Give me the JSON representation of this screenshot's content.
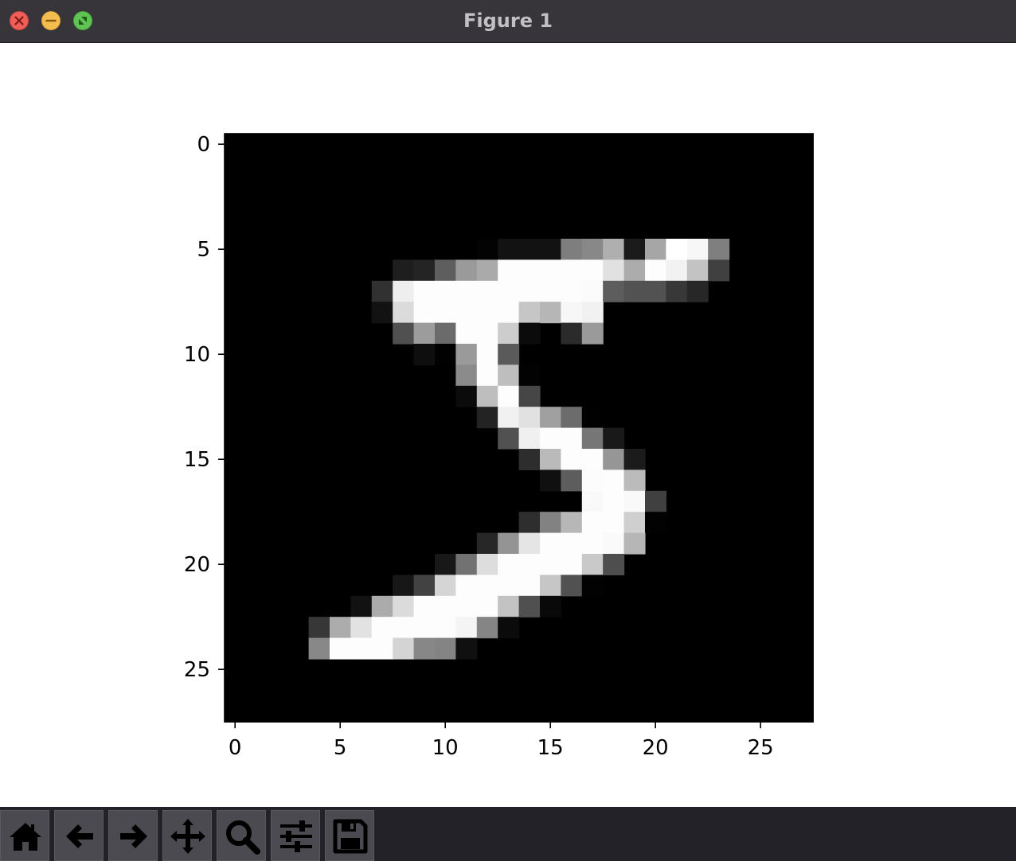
{
  "window": {
    "title": "Figure 1"
  },
  "toolbar": {
    "buttons": [
      {
        "name": "home",
        "icon": "home-icon"
      },
      {
        "name": "back",
        "icon": "arrow-left-icon"
      },
      {
        "name": "forward",
        "icon": "arrow-right-icon"
      },
      {
        "name": "pan",
        "icon": "move-icon"
      },
      {
        "name": "zoom",
        "icon": "magnifier-icon"
      },
      {
        "name": "configure-subplots",
        "icon": "sliders-icon"
      },
      {
        "name": "save",
        "icon": "floppy-disk-icon"
      }
    ]
  },
  "chart_data": {
    "type": "heatmap",
    "colormap": "gray",
    "xlim": [
      -0.5,
      27.5
    ],
    "ylim": [
      27.5,
      -0.5
    ],
    "xticks": [
      "0",
      "5",
      "10",
      "15",
      "20",
      "25"
    ],
    "yticks": [
      "0",
      "5",
      "10",
      "15",
      "20",
      "25"
    ],
    "rows": 28,
    "cols": 28,
    "values": [
      [
        0,
        0,
        0,
        0,
        0,
        0,
        0,
        0,
        0,
        0,
        0,
        0,
        0,
        0,
        0,
        0,
        0,
        0,
        0,
        0,
        0,
        0,
        0,
        0,
        0,
        0,
        0,
        0
      ],
      [
        0,
        0,
        0,
        0,
        0,
        0,
        0,
        0,
        0,
        0,
        0,
        0,
        0,
        0,
        0,
        0,
        0,
        0,
        0,
        0,
        0,
        0,
        0,
        0,
        0,
        0,
        0,
        0
      ],
      [
        0,
        0,
        0,
        0,
        0,
        0,
        0,
        0,
        0,
        0,
        0,
        0,
        0,
        0,
        0,
        0,
        0,
        0,
        0,
        0,
        0,
        0,
        0,
        0,
        0,
        0,
        0,
        0
      ],
      [
        0,
        0,
        0,
        0,
        0,
        0,
        0,
        0,
        0,
        0,
        0,
        0,
        0,
        0,
        0,
        0,
        0,
        0,
        0,
        0,
        0,
        0,
        0,
        0,
        0,
        0,
        0,
        0
      ],
      [
        0,
        0,
        0,
        0,
        0,
        0,
        0,
        0,
        0,
        0,
        0,
        0,
        0,
        0,
        0,
        0,
        0,
        0,
        0,
        0,
        0,
        0,
        0,
        0,
        0,
        0,
        0,
        0
      ],
      [
        0,
        0,
        0,
        0,
        0,
        0,
        0,
        0,
        0,
        0,
        0,
        0,
        3,
        18,
        18,
        18,
        126,
        136,
        175,
        26,
        166,
        255,
        247,
        127,
        0,
        0,
        0,
        0
      ],
      [
        0,
        0,
        0,
        0,
        0,
        0,
        0,
        0,
        30,
        36,
        94,
        154,
        170,
        253,
        253,
        253,
        253,
        253,
        225,
        172,
        253,
        242,
        195,
        64,
        0,
        0,
        0,
        0
      ],
      [
        0,
        0,
        0,
        0,
        0,
        0,
        0,
        49,
        238,
        253,
        253,
        253,
        253,
        253,
        253,
        253,
        253,
        251,
        93,
        82,
        82,
        56,
        39,
        0,
        0,
        0,
        0,
        0
      ],
      [
        0,
        0,
        0,
        0,
        0,
        0,
        0,
        18,
        219,
        253,
        253,
        253,
        253,
        253,
        198,
        182,
        247,
        241,
        0,
        0,
        0,
        0,
        0,
        0,
        0,
        0,
        0,
        0
      ],
      [
        0,
        0,
        0,
        0,
        0,
        0,
        0,
        0,
        80,
        156,
        107,
        253,
        253,
        205,
        11,
        0,
        43,
        154,
        0,
        0,
        0,
        0,
        0,
        0,
        0,
        0,
        0,
        0
      ],
      [
        0,
        0,
        0,
        0,
        0,
        0,
        0,
        0,
        0,
        14,
        1,
        154,
        253,
        90,
        0,
        0,
        0,
        0,
        0,
        0,
        0,
        0,
        0,
        0,
        0,
        0,
        0,
        0
      ],
      [
        0,
        0,
        0,
        0,
        0,
        0,
        0,
        0,
        0,
        0,
        0,
        139,
        253,
        190,
        2,
        0,
        0,
        0,
        0,
        0,
        0,
        0,
        0,
        0,
        0,
        0,
        0,
        0
      ],
      [
        0,
        0,
        0,
        0,
        0,
        0,
        0,
        0,
        0,
        0,
        0,
        11,
        190,
        253,
        70,
        0,
        0,
        0,
        0,
        0,
        0,
        0,
        0,
        0,
        0,
        0,
        0,
        0
      ],
      [
        0,
        0,
        0,
        0,
        0,
        0,
        0,
        0,
        0,
        0,
        0,
        0,
        35,
        241,
        225,
        160,
        108,
        1,
        0,
        0,
        0,
        0,
        0,
        0,
        0,
        0,
        0,
        0
      ],
      [
        0,
        0,
        0,
        0,
        0,
        0,
        0,
        0,
        0,
        0,
        0,
        0,
        0,
        81,
        240,
        253,
        253,
        119,
        25,
        0,
        0,
        0,
        0,
        0,
        0,
        0,
        0,
        0
      ],
      [
        0,
        0,
        0,
        0,
        0,
        0,
        0,
        0,
        0,
        0,
        0,
        0,
        0,
        0,
        45,
        186,
        253,
        253,
        150,
        27,
        0,
        0,
        0,
        0,
        0,
        0,
        0,
        0
      ],
      [
        0,
        0,
        0,
        0,
        0,
        0,
        0,
        0,
        0,
        0,
        0,
        0,
        0,
        0,
        0,
        16,
        93,
        252,
        253,
        187,
        0,
        0,
        0,
        0,
        0,
        0,
        0,
        0
      ],
      [
        0,
        0,
        0,
        0,
        0,
        0,
        0,
        0,
        0,
        0,
        0,
        0,
        0,
        0,
        0,
        0,
        0,
        249,
        253,
        249,
        64,
        0,
        0,
        0,
        0,
        0,
        0,
        0
      ],
      [
        0,
        0,
        0,
        0,
        0,
        0,
        0,
        0,
        0,
        0,
        0,
        0,
        0,
        0,
        46,
        130,
        183,
        253,
        253,
        207,
        2,
        0,
        0,
        0,
        0,
        0,
        0,
        0
      ],
      [
        0,
        0,
        0,
        0,
        0,
        0,
        0,
        0,
        0,
        0,
        0,
        0,
        39,
        148,
        229,
        253,
        253,
        253,
        250,
        182,
        0,
        0,
        0,
        0,
        0,
        0,
        0,
        0
      ],
      [
        0,
        0,
        0,
        0,
        0,
        0,
        0,
        0,
        0,
        0,
        24,
        114,
        221,
        253,
        253,
        253,
        253,
        201,
        78,
        0,
        0,
        0,
        0,
        0,
        0,
        0,
        0,
        0
      ],
      [
        0,
        0,
        0,
        0,
        0,
        0,
        0,
        0,
        23,
        66,
        213,
        253,
        253,
        253,
        253,
        198,
        81,
        2,
        0,
        0,
        0,
        0,
        0,
        0,
        0,
        0,
        0,
        0
      ],
      [
        0,
        0,
        0,
        0,
        0,
        0,
        18,
        171,
        219,
        253,
        253,
        253,
        253,
        195,
        80,
        9,
        0,
        0,
        0,
        0,
        0,
        0,
        0,
        0,
        0,
        0,
        0,
        0
      ],
      [
        0,
        0,
        0,
        0,
        55,
        172,
        226,
        253,
        253,
        253,
        253,
        244,
        133,
        11,
        0,
        0,
        0,
        0,
        0,
        0,
        0,
        0,
        0,
        0,
        0,
        0,
        0,
        0
      ],
      [
        0,
        0,
        0,
        0,
        136,
        253,
        253,
        253,
        212,
        135,
        132,
        16,
        0,
        0,
        0,
        0,
        0,
        0,
        0,
        0,
        0,
        0,
        0,
        0,
        0,
        0,
        0,
        0
      ],
      [
        0,
        0,
        0,
        0,
        0,
        0,
        0,
        0,
        0,
        0,
        0,
        0,
        0,
        0,
        0,
        0,
        0,
        0,
        0,
        0,
        0,
        0,
        0,
        0,
        0,
        0,
        0,
        0
      ],
      [
        0,
        0,
        0,
        0,
        0,
        0,
        0,
        0,
        0,
        0,
        0,
        0,
        0,
        0,
        0,
        0,
        0,
        0,
        0,
        0,
        0,
        0,
        0,
        0,
        0,
        0,
        0,
        0
      ],
      [
        0,
        0,
        0,
        0,
        0,
        0,
        0,
        0,
        0,
        0,
        0,
        0,
        0,
        0,
        0,
        0,
        0,
        0,
        0,
        0,
        0,
        0,
        0,
        0,
        0,
        0,
        0,
        0
      ]
    ]
  }
}
